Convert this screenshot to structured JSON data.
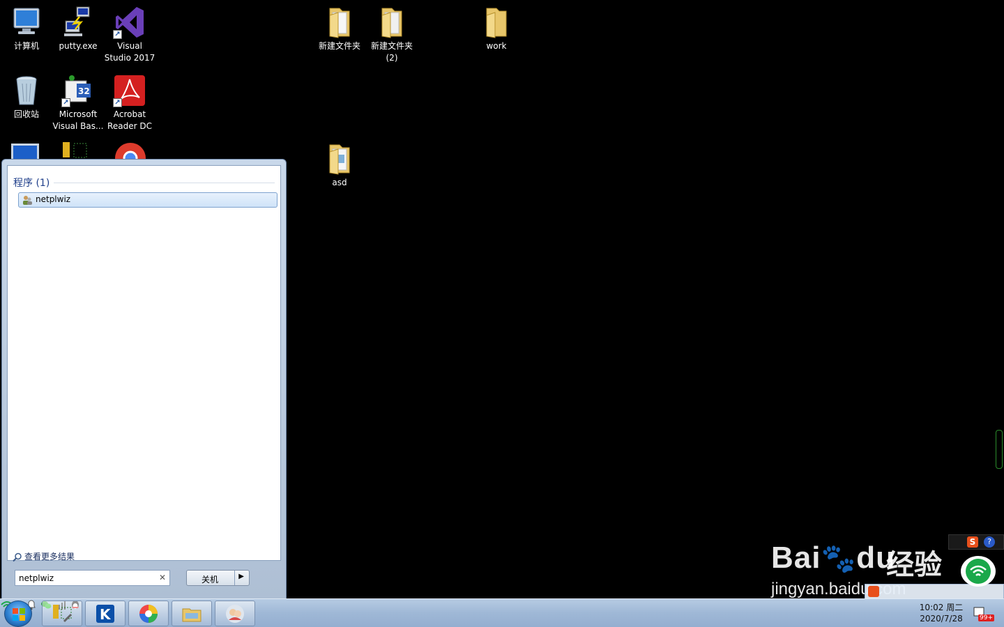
{
  "desktop": {
    "icons": [
      {
        "label": "计算机"
      },
      {
        "label": "putty.exe"
      },
      {
        "label": "Visual Studio 2017"
      },
      {
        "label": "新建文件夹"
      },
      {
        "label": "新建文件夹 (2)"
      },
      {
        "label": "work"
      },
      {
        "label": "回收站"
      },
      {
        "label": "Microsoft Visual Bas..."
      },
      {
        "label": "Acrobat Reader DC"
      },
      {
        "label": "asd"
      }
    ]
  },
  "start_menu": {
    "category_label": "程序 (1)",
    "result_label": "netplwiz",
    "see_more_label": "查看更多结果",
    "search_value": "netplwiz",
    "shutdown_label": "关机"
  },
  "taskbar": {
    "clock_time": "10:02 周二",
    "clock_date": "2020/7/28",
    "notification_badge": "99+"
  },
  "watermark": {
    "brand": "Bai",
    "brand2": "du",
    "product": "经验",
    "url": "jingyan.baidu.com"
  }
}
